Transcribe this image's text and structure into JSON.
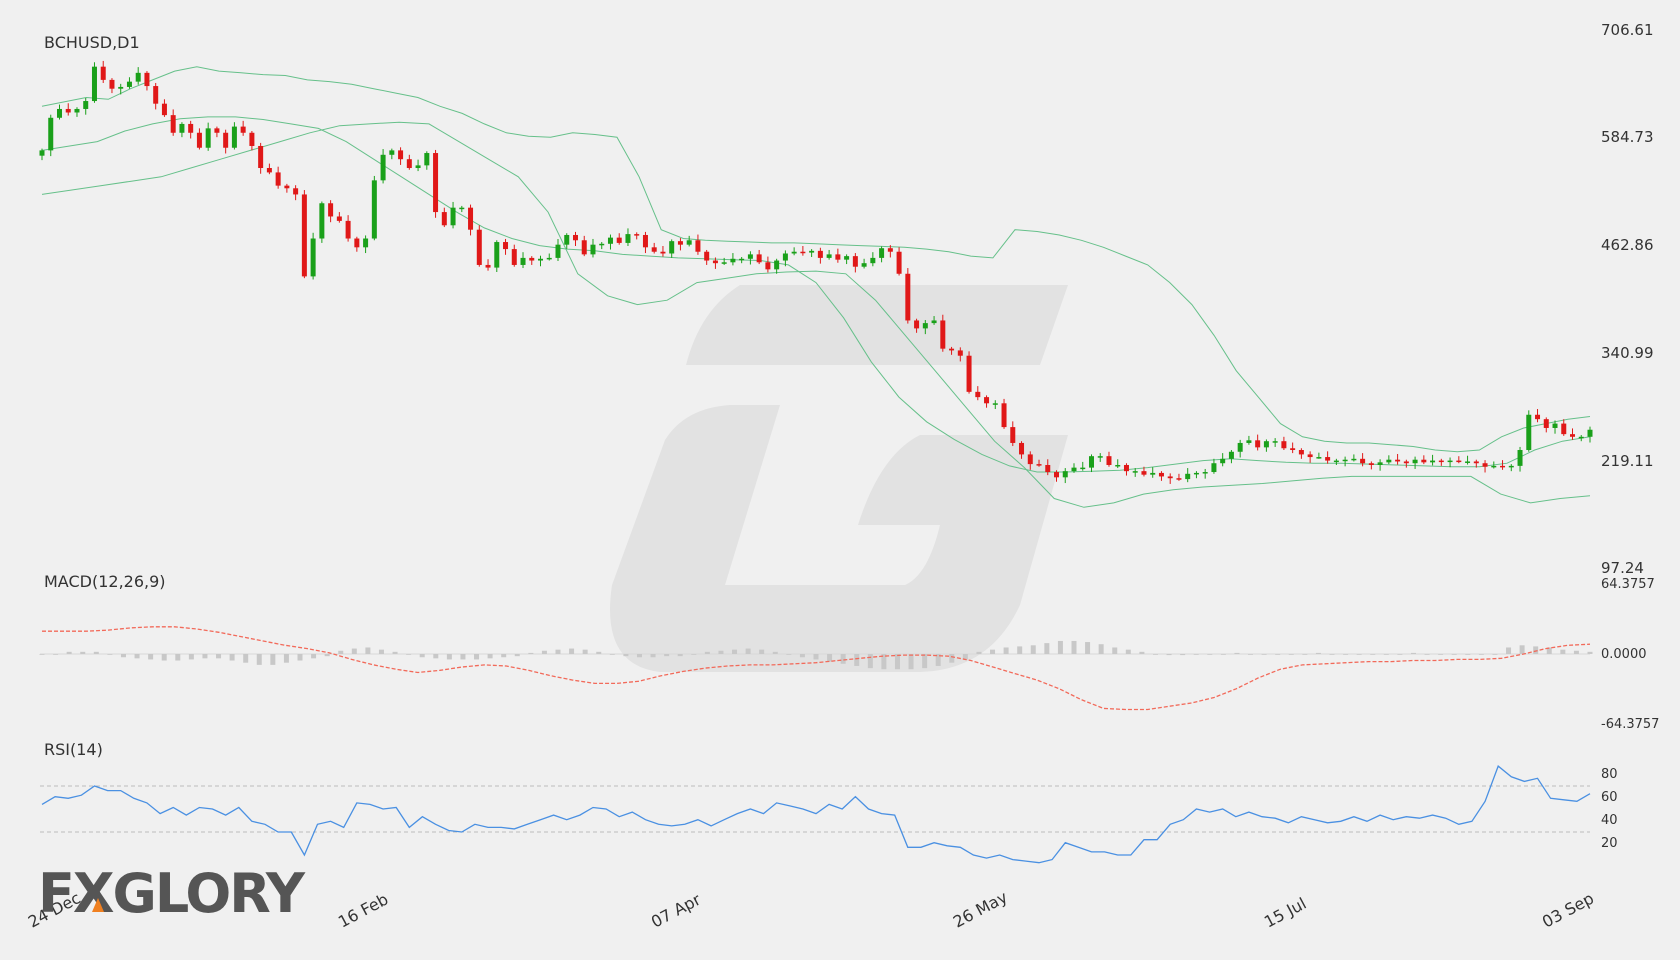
{
  "branding": {
    "logo_text": "FXGLORY"
  },
  "colors": {
    "background": "#f0f0f0",
    "bull": "#1aa01a",
    "bear": "#e01818",
    "bands": "#66c08a",
    "macd_signal": "#f26a5a",
    "macd_hist": "#c8c8c8",
    "rsi_line": "#4a90e2",
    "rsi_levels": "#bbbbbb",
    "watermark": "#e2e2e2"
  },
  "chart_data": [
    {
      "type": "candlestick",
      "title": "BCHUSD,D1",
      "y_ticks": [
        706.61,
        584.73,
        462.86,
        340.99,
        219.11,
        97.24
      ],
      "ylim": [
        97.24,
        706.61
      ],
      "x_ticks": [
        "24 Dec",
        "16 Feb",
        "07 Apr",
        "26 May",
        "15 Jul",
        "03 Sep"
      ],
      "indicator": "Bollinger Bands (20,2)",
      "ohlc_close_approx": [
        570,
        607,
        617,
        613,
        617,
        626,
        665,
        650,
        640,
        642,
        648,
        658,
        643,
        623,
        610,
        590,
        600,
        590,
        573,
        595,
        590,
        573,
        597,
        590,
        575,
        550,
        545,
        530,
        527,
        520,
        427,
        470,
        510,
        495,
        490,
        470,
        460,
        470,
        536,
        565,
        570,
        560,
        550,
        553,
        567,
        500,
        485,
        505,
        505,
        480,
        440,
        437,
        466,
        458,
        440,
        448,
        445,
        447,
        448,
        463,
        474,
        468,
        452,
        463,
        464,
        471,
        465,
        475,
        474,
        460,
        455,
        453,
        467,
        463,
        468,
        455,
        445,
        442,
        443,
        447,
        447,
        452,
        443,
        435,
        445,
        453,
        455,
        454,
        456,
        448,
        452,
        446,
        450,
        438,
        442,
        448,
        459,
        455,
        430,
        377,
        368,
        374,
        377,
        345,
        343,
        337,
        296,
        290,
        283,
        283,
        256,
        238,
        225,
        214,
        213,
        205,
        199,
        206,
        210,
        210,
        223,
        223,
        213,
        213,
        206,
        206,
        202,
        204,
        200,
        198,
        197,
        203,
        204,
        205,
        215,
        220,
        228,
        238,
        241,
        233,
        240,
        240,
        232,
        230,
        225,
        222,
        222,
        218,
        218,
        219,
        220,
        215,
        213,
        216,
        219,
        217,
        215,
        219,
        216,
        218,
        217,
        218,
        217,
        217,
        215,
        211,
        212,
        211,
        212,
        230,
        270,
        265,
        255,
        260,
        248,
        245,
        245,
        253
      ],
      "bb_upper_approx": [
        620,
        625,
        630,
        628,
        640,
        650,
        660,
        665,
        660,
        658,
        656,
        655,
        650,
        648,
        645,
        640,
        635,
        630,
        620,
        612,
        600,
        590,
        586,
        585,
        590,
        588,
        585,
        540,
        480,
        470,
        468,
        467,
        466,
        465,
        465,
        464,
        463,
        462,
        461,
        460,
        458,
        455,
        450,
        448,
        480,
        478,
        474,
        468,
        460,
        450,
        440,
        420,
        395,
        360,
        320,
        290,
        260,
        245,
        240,
        238,
        238,
        236,
        234,
        230,
        228,
        230,
        245,
        255,
        260,
        265,
        268
      ],
      "bb_middle_approx": [
        570,
        575,
        580,
        592,
        600,
        606,
        608,
        608,
        605,
        600,
        595,
        580,
        560,
        540,
        520,
        500,
        482,
        470,
        462,
        458,
        456,
        452,
        450,
        448,
        447,
        446,
        445,
        440,
        420,
        380,
        330,
        290,
        262,
        242,
        225,
        212,
        205,
        205,
        206,
        207,
        210,
        214,
        218,
        220,
        218,
        216,
        215,
        215,
        214,
        213,
        212,
        211,
        211,
        215,
        230,
        240,
        245
      ],
      "bb_lower_approx": [
        520,
        525,
        530,
        535,
        540,
        550,
        560,
        570,
        580,
        590,
        598,
        600,
        602,
        600,
        580,
        560,
        540,
        500,
        430,
        405,
        395,
        400,
        420,
        425,
        430,
        432,
        433,
        430,
        400,
        360,
        320,
        280,
        240,
        210,
        175,
        165,
        170,
        180,
        185,
        188,
        190,
        192,
        195,
        198,
        200,
        200,
        200,
        200,
        200,
        180,
        170,
        175,
        178
      ]
    },
    {
      "type": "histogram+line",
      "title": "MACD(12,26,9)",
      "y_ticks": [
        64.3757,
        0.0,
        -64.3757
      ],
      "ylim": [
        -64.3757,
        64.3757
      ],
      "signal_approx": [
        21,
        21,
        21,
        22,
        24,
        25,
        25,
        23,
        20,
        16,
        12,
        8,
        5,
        1,
        -5,
        -10,
        -14,
        -17,
        -15,
        -12,
        -10,
        -11,
        -15,
        -20,
        -24,
        -27,
        -27,
        -25,
        -20,
        -16,
        -13,
        -11,
        -10,
        -10,
        -9,
        -8,
        -6,
        -4,
        -2,
        -1,
        -1,
        -2,
        -6,
        -12,
        -18,
        -24,
        -32,
        -42,
        -50,
        -51,
        -51,
        -48,
        -45,
        -40,
        -32,
        -22,
        -14,
        -10,
        -9,
        -8,
        -7,
        -7,
        -6,
        -6,
        -5,
        -5,
        -4,
        0,
        5,
        8,
        9
      ],
      "histogram_approx": [
        0,
        0,
        2,
        2,
        2,
        0,
        -3,
        -4,
        -5,
        -6,
        -6,
        -5,
        -4,
        -4,
        -6,
        -8,
        -10,
        -10,
        -8,
        -6,
        -4,
        -2,
        3,
        5,
        6,
        4,
        2,
        0,
        -3,
        -4,
        -5,
        -5,
        -5,
        -4,
        -3,
        -2,
        1,
        3,
        4,
        5,
        4,
        2,
        0,
        -2,
        -3,
        -3,
        -2,
        -2,
        0,
        2,
        3,
        4,
        5,
        4,
        2,
        0,
        -3,
        -5,
        -7,
        -9,
        -11,
        -13,
        -14,
        -14,
        -14,
        -13,
        -11,
        -8,
        -5,
        2,
        4,
        6,
        7,
        8,
        10,
        12,
        12,
        11,
        9,
        6,
        4,
        2,
        0,
        -1,
        -1,
        0,
        0,
        0,
        1,
        0,
        0,
        0,
        0,
        0,
        1,
        0,
        0,
        0,
        0,
        0,
        0,
        1,
        0,
        0,
        0,
        0,
        0,
        0,
        6,
        8,
        7,
        6,
        4,
        3,
        2
      ]
    },
    {
      "type": "line",
      "title": "RSI(14)",
      "y_ticks": [
        80,
        60,
        40,
        20
      ],
      "ylim": [
        0,
        100
      ],
      "levels": [
        70,
        30
      ],
      "values_approx": [
        53,
        58,
        57,
        59,
        65,
        62,
        62,
        57,
        54,
        47,
        51,
        46,
        51,
        50,
        46,
        51,
        42,
        40,
        35,
        35,
        20,
        40,
        42,
        38,
        54,
        53,
        50,
        51,
        38,
        45,
        40,
        36,
        35,
        40,
        38,
        38,
        37,
        40,
        43,
        46,
        43,
        46,
        51,
        50,
        45,
        48,
        43,
        40,
        39,
        40,
        43,
        39,
        43,
        47,
        50,
        47,
        54,
        52,
        50,
        47,
        53,
        50,
        58,
        50,
        47,
        46,
        25,
        25,
        28,
        26,
        25,
        20,
        18,
        20,
        17,
        16,
        15,
        17,
        28,
        25,
        22,
        22,
        20,
        20,
        30,
        30,
        40,
        43,
        50,
        48,
        50,
        45,
        48,
        45,
        44,
        41,
        45,
        43,
        41,
        42,
        45,
        42,
        46,
        43,
        45,
        44,
        46,
        44,
        40,
        42,
        55,
        78,
        71,
        68,
        70,
        57,
        56,
        55,
        60
      ]
    }
  ]
}
